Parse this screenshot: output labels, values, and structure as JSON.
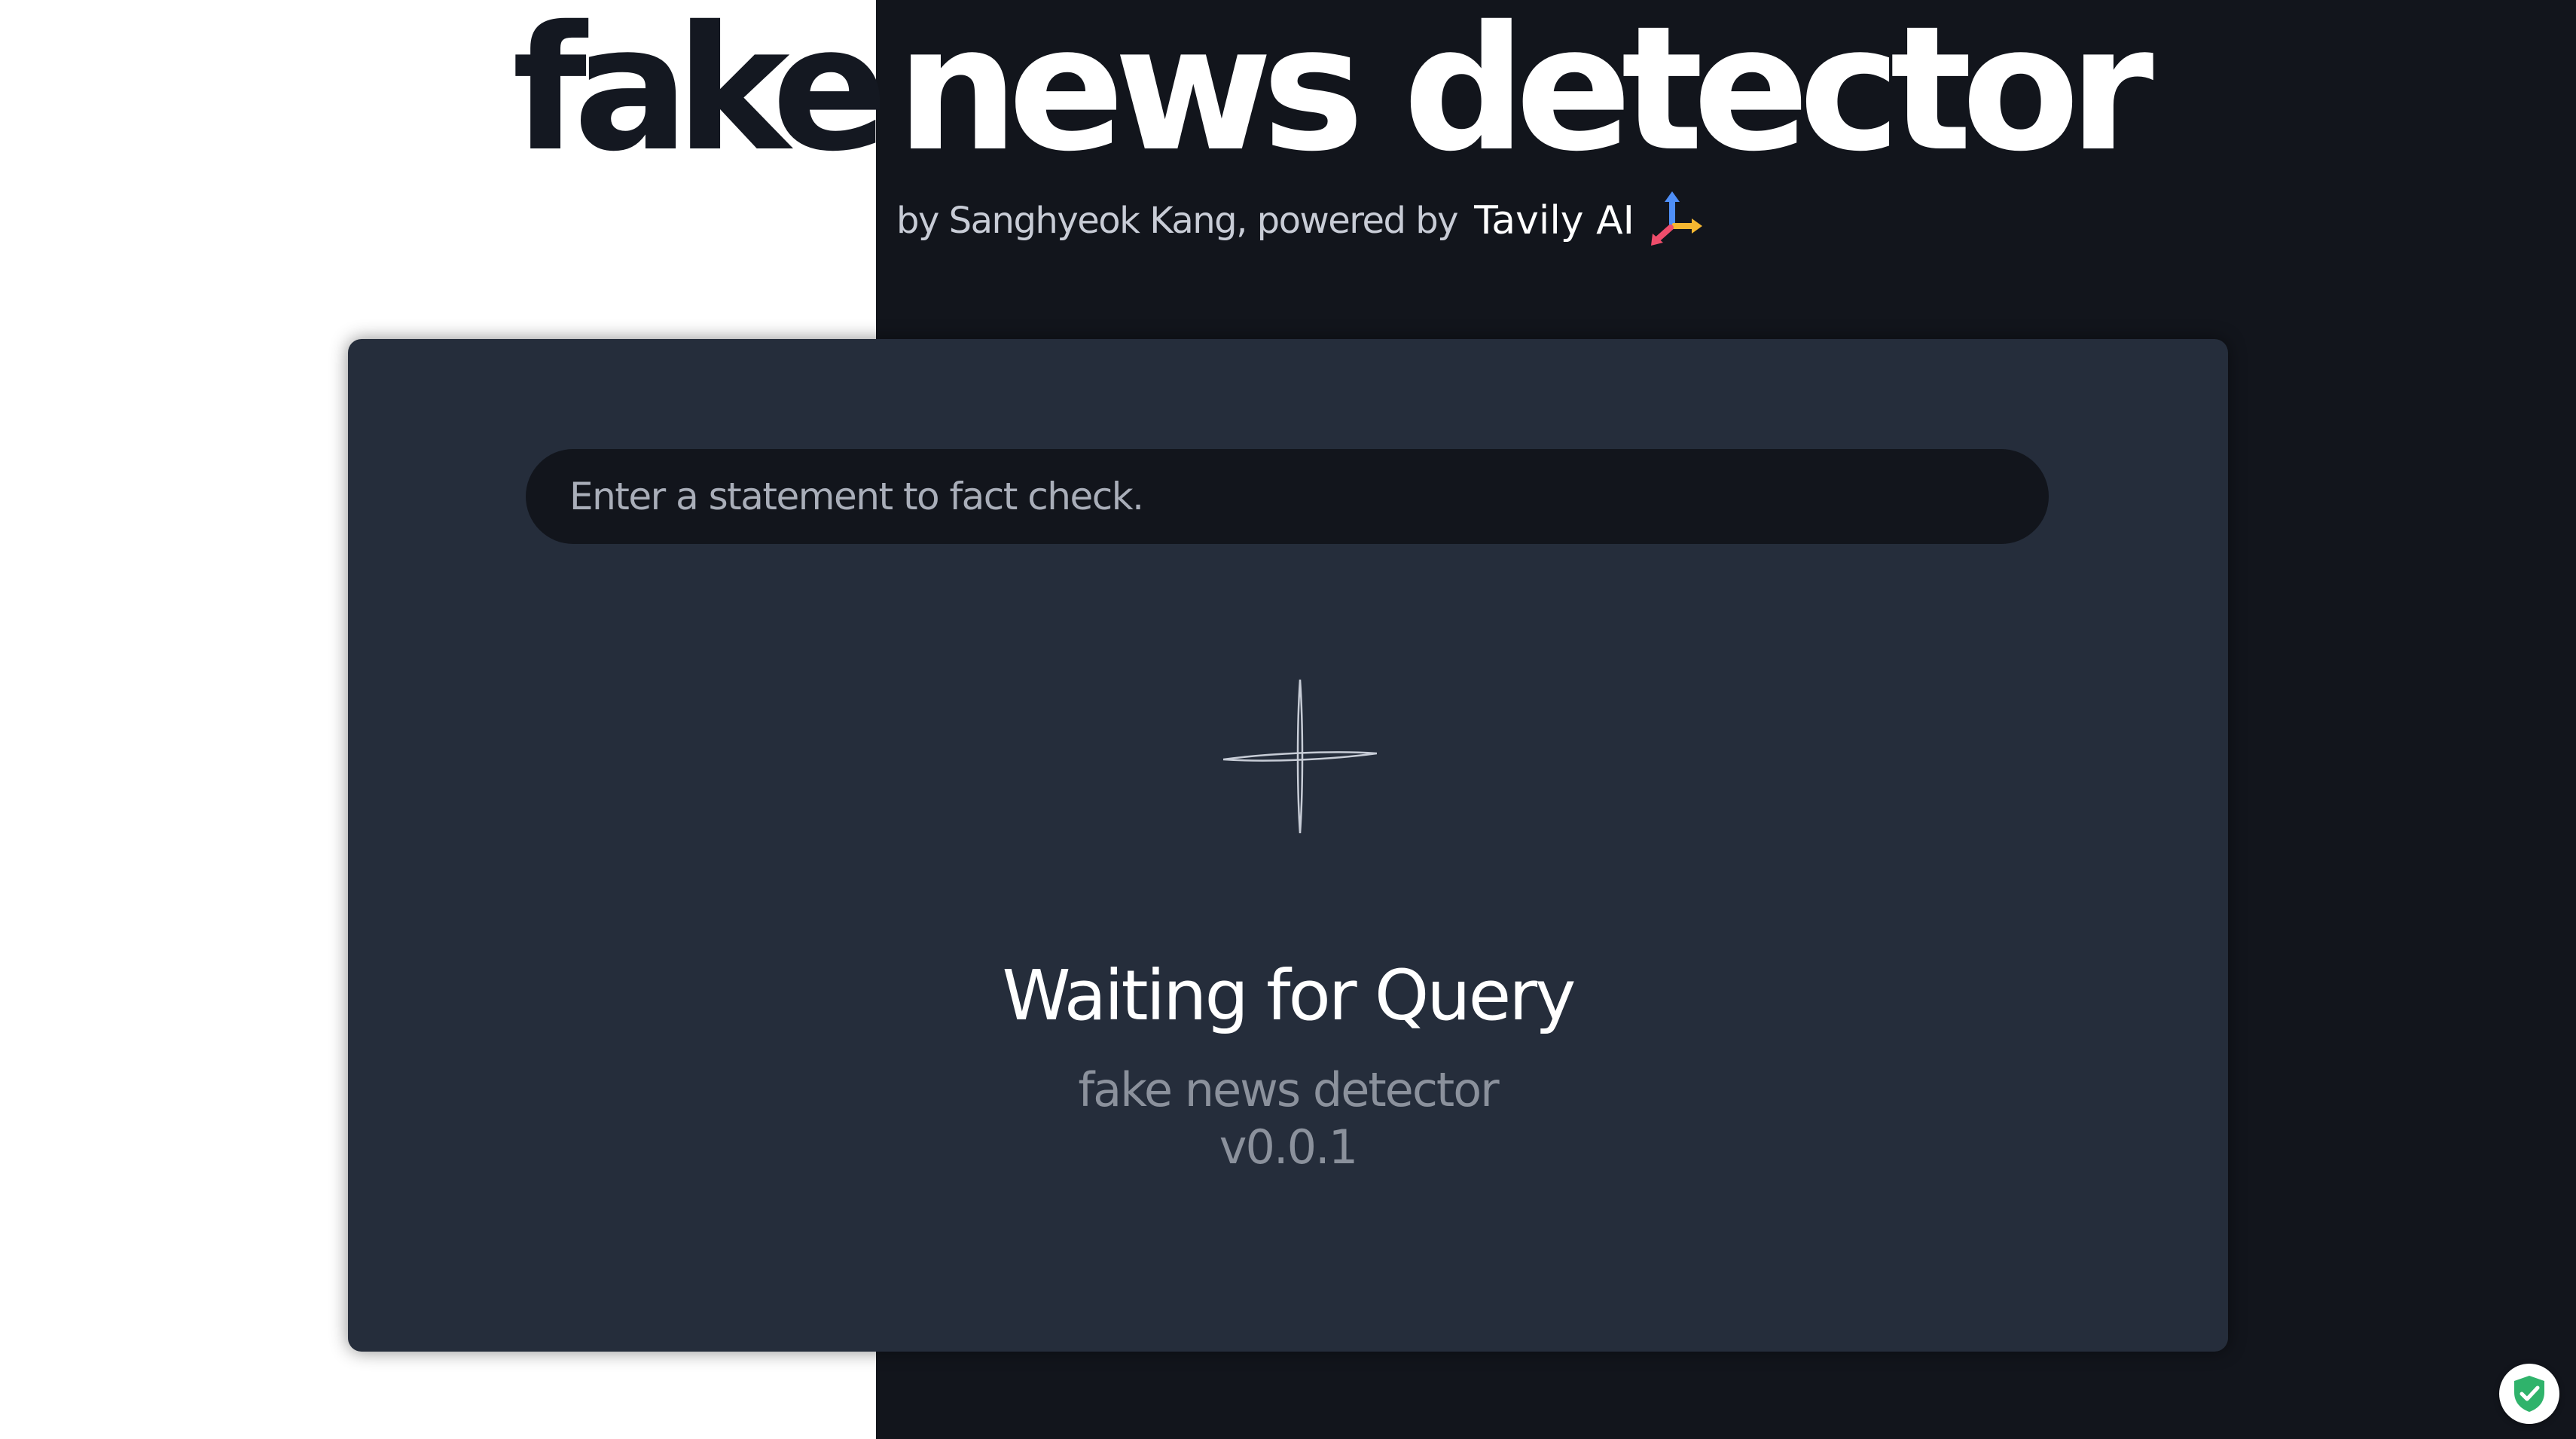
{
  "header": {
    "title_left": "fake",
    "title_right": "news detector",
    "byline_prefix": "by Sanghyeok Kang, powered by",
    "brand_name": "Tavily AI",
    "brand_logo_icon": "tavily-logo-icon"
  },
  "search": {
    "placeholder": "Enter a statement to fact check.",
    "value": ""
  },
  "status": {
    "icon": "sparkle-icon",
    "title": "Waiting for Query",
    "app_name": "fake news detector",
    "version": "v0.0.1"
  },
  "badge": {
    "icon": "shield-check-icon"
  },
  "colors": {
    "background_dark": "#12151c",
    "card": "#252d3b",
    "input": "#12151c",
    "accent_green": "#2fb36b"
  }
}
